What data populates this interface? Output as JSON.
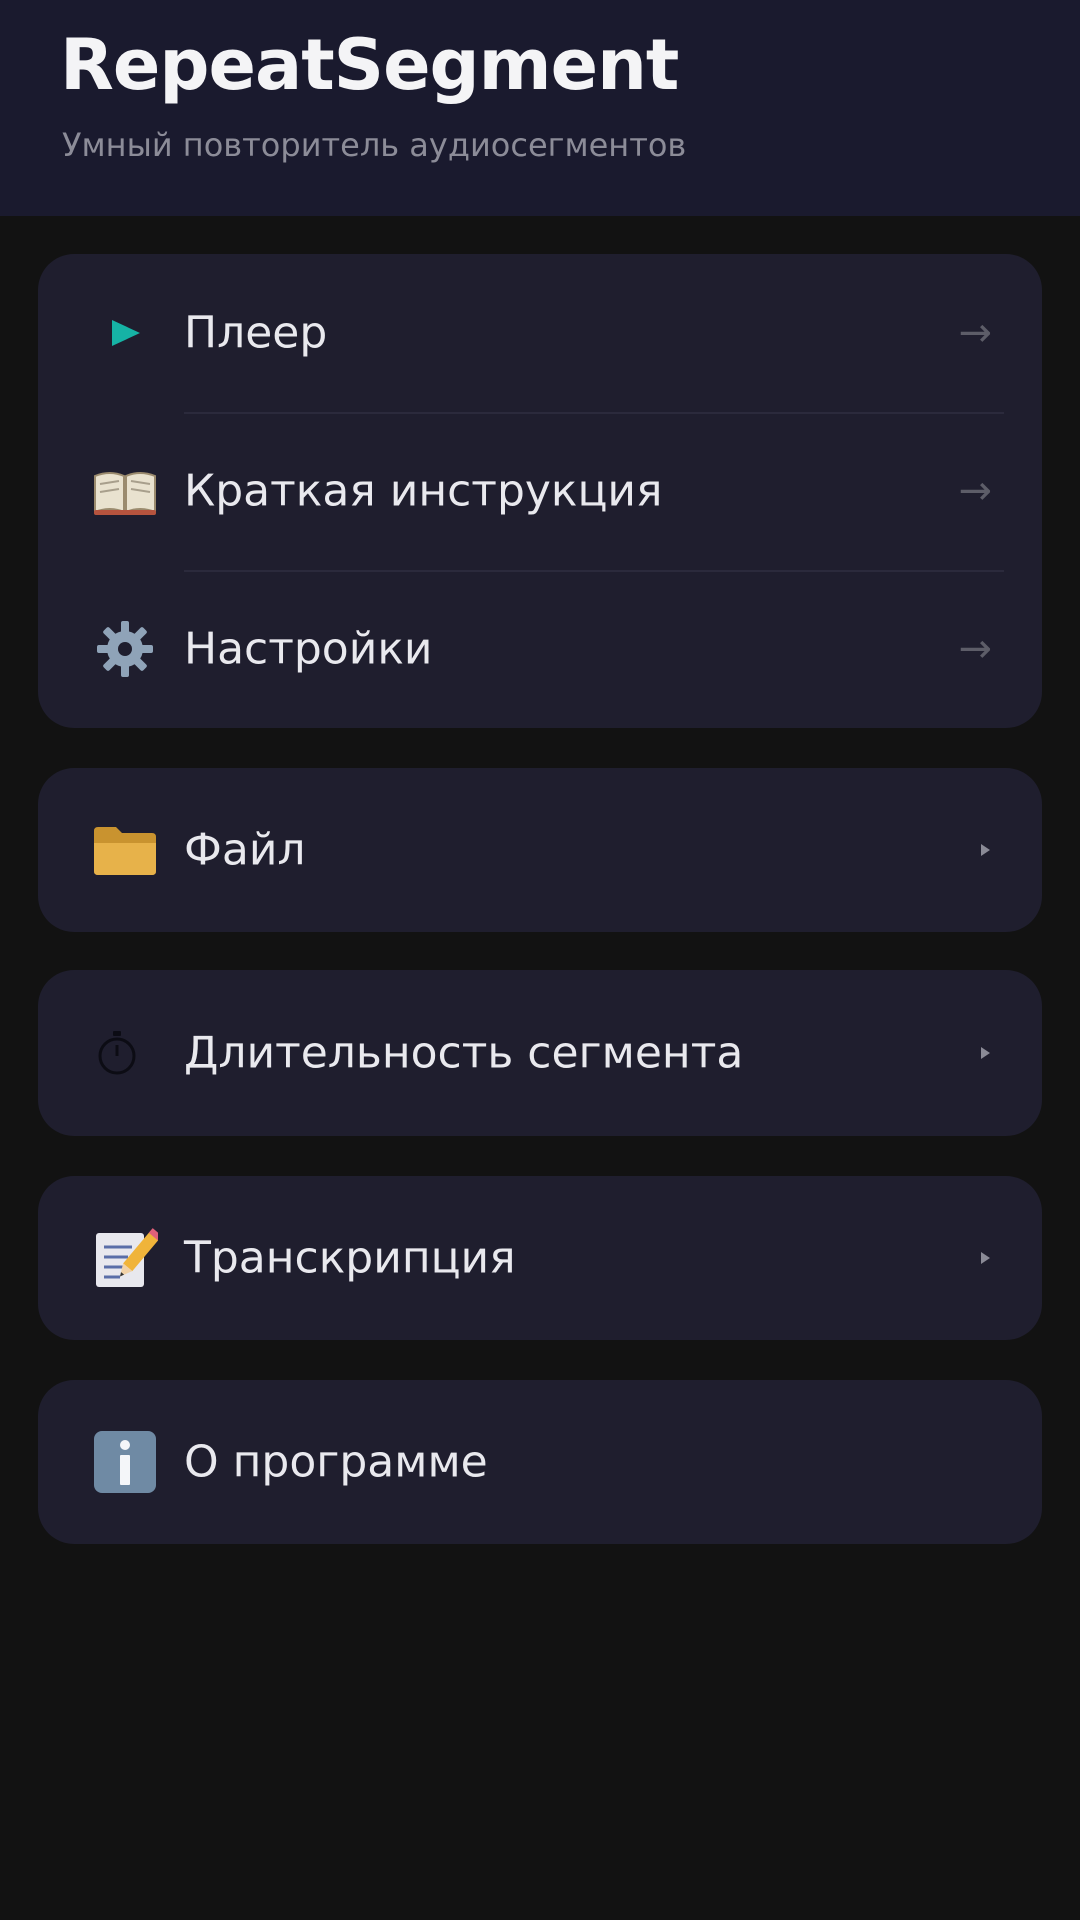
{
  "header": {
    "title": "RepeatSegment",
    "subtitle": "Умный повторитель аудиосегментов"
  },
  "main_menu": [
    {
      "label": "Плеер",
      "icon": "play-icon",
      "trailing": "→"
    },
    {
      "label": "Краткая инструкция",
      "icon": "book-icon",
      "trailing": "→"
    },
    {
      "label": "Настройки",
      "icon": "gear-icon",
      "trailing": "→"
    }
  ],
  "sections": [
    {
      "label": "Файл",
      "icon": "folder-icon"
    },
    {
      "label": "Длительность сегмента",
      "icon": "stopwatch-icon"
    },
    {
      "label": "Транскрипция",
      "icon": "memo-icon"
    },
    {
      "label": "О программе",
      "icon": "info-icon"
    }
  ],
  "colors": {
    "header_bg": "#1a1a2e",
    "card_bg": "#1f1e2e",
    "page_bg": "#121212",
    "accent": "#16b3a5"
  }
}
